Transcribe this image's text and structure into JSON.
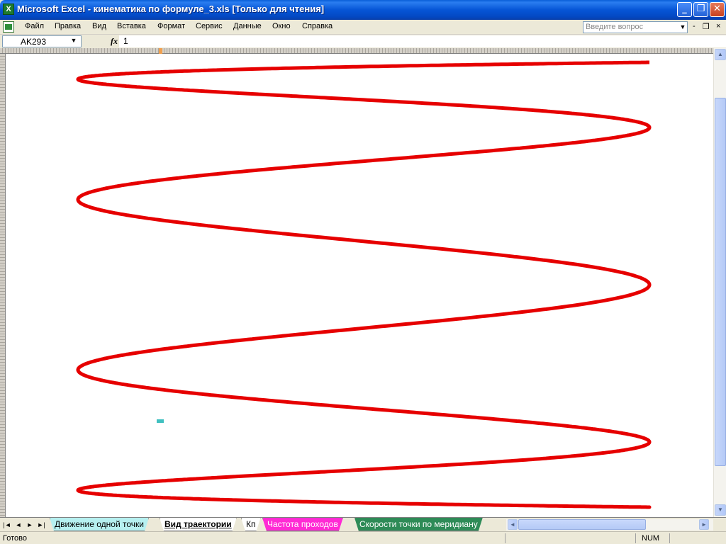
{
  "window": {
    "title": "Microsoft Excel - кинематика по формуле_3.xls  [Только для чтения]",
    "app_icon": "excel-icon",
    "minimize": "_",
    "maximize": "❐",
    "close": "✕"
  },
  "menu": {
    "items": [
      "Файл",
      "Правка",
      "Вид",
      "Вставка",
      "Формат",
      "Сервис",
      "Данные",
      "Окно",
      "Справка"
    ],
    "help_placeholder": "Введите вопрос",
    "help_arrow": "▼",
    "doc_minimize": "-",
    "doc_restore": "❐",
    "doc_close": "×"
  },
  "formula_bar": {
    "name_box": "AK293",
    "name_arrow": "▼",
    "fx_label": "fx",
    "value": "1"
  },
  "colors": {
    "curve": "#e60000",
    "selected_cell": "#40c0c0"
  },
  "chart_data": {
    "type": "line",
    "title": "",
    "xlabel": "",
    "ylabel": "",
    "description_hidden": false,
    "series": [
      {
        "name": "",
        "curve": "lissajous-like trajectory with 4 loops",
        "loops": 4,
        "x_range": [
          -1,
          1
        ],
        "y_range": [
          -1,
          1
        ],
        "freq_ratio": "1:8"
      }
    ]
  },
  "scroll": {
    "up": "▲",
    "down": "▼",
    "left": "◄",
    "right": "►"
  },
  "tabs": {
    "nav": [
      "|◄",
      "◄",
      "►",
      "►|"
    ],
    "items": [
      {
        "label": "Движение одной точки",
        "bg": "#b6f0f0",
        "color": "#000000",
        "active": false
      },
      {
        "label": "Вид траектории",
        "bg": "#ffffff",
        "color": "#000000",
        "active": true
      },
      {
        "label": "Кп",
        "bg": "#ffffff",
        "color": "#000000",
        "active": false
      },
      {
        "label": "Частота проходов",
        "bg": "#ff2ad4",
        "color": "#ffffff",
        "active": false
      },
      {
        "label": "Скорости точки по меридиану",
        "bg": "#2e8b57",
        "color": "#ffffff",
        "active": false
      }
    ]
  },
  "status": {
    "text": "Готово",
    "num": "NUM"
  }
}
